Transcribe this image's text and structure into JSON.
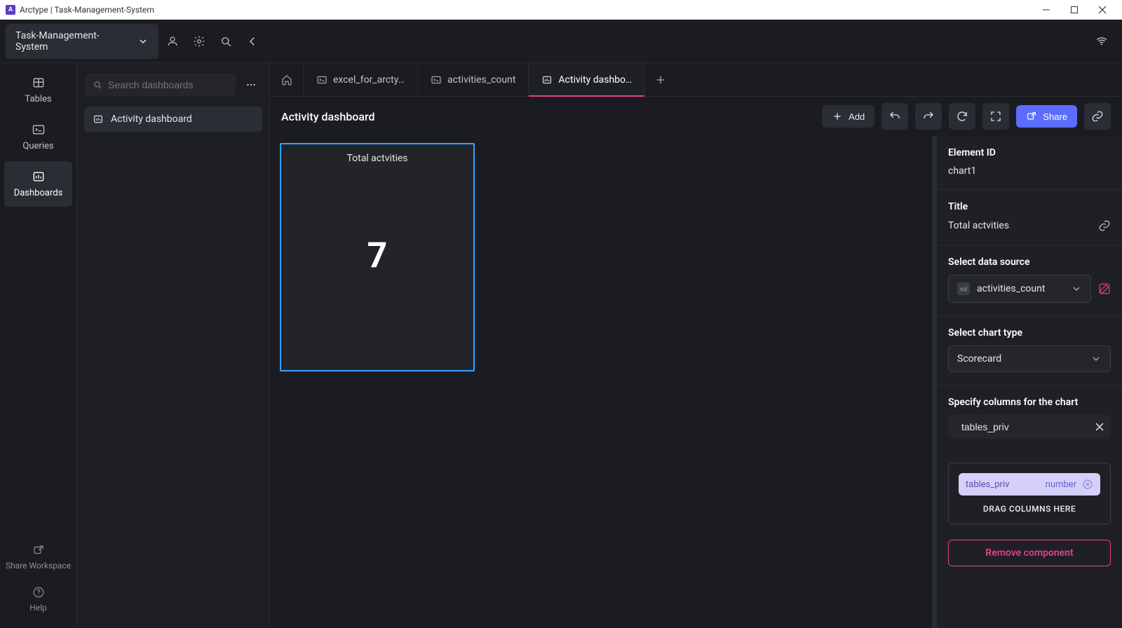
{
  "titlebar": {
    "title": "Arctype | Task-Management-System"
  },
  "workspace": {
    "name": "Task-Management-System"
  },
  "rail": {
    "tables": "Tables",
    "queries": "Queries",
    "dashboards": "Dashboards",
    "share": "Share Workspace",
    "help": "Help"
  },
  "sidebar": {
    "search_placeholder": "Search dashboards",
    "items": [
      "Activity dashboard"
    ]
  },
  "tabs": {
    "items": [
      {
        "label": "excel_for_arcty…",
        "icon": "query"
      },
      {
        "label": "activities_count",
        "icon": "query"
      },
      {
        "label": "Activity dashbo…",
        "icon": "dashboard",
        "active": true
      }
    ]
  },
  "toolbar": {
    "title": "Activity dashboard",
    "add": "Add",
    "share": "Share"
  },
  "card": {
    "title": "Total actvities",
    "value": "7"
  },
  "panel": {
    "element_id_label": "Element ID",
    "element_id": "chart1",
    "title_label": "Title",
    "title_value": "Total actvities",
    "data_source_label": "Select data source",
    "data_source": "activities_count",
    "chart_type_label": "Select chart type",
    "chart_type": "Scorecard",
    "columns_label": "Specify columns for the chart",
    "column_search": "tables_priv",
    "chip_name": "tables_priv",
    "chip_type": "number",
    "drag_hint": "DRAG COLUMNS HERE",
    "remove": "Remove component"
  },
  "chart_data": {
    "type": "table",
    "title": "Total actvities",
    "categories": [
      "tables_priv"
    ],
    "values": [
      7
    ]
  }
}
